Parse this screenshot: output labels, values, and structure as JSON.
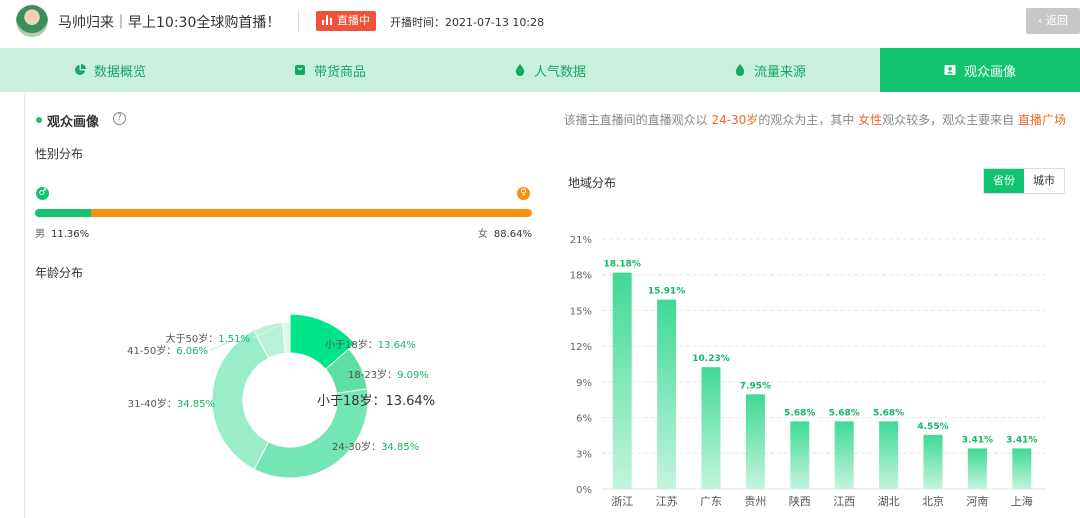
{
  "header": {
    "streamer_title": "马帅归来｜早上10:30全球购首播！",
    "live_badge": "直播中",
    "start_time_label": "开播时间：",
    "start_time": "2021-07-13 10:28",
    "back_label": "返回"
  },
  "tabs": [
    {
      "label": "数据概览",
      "icon": "pie-icon"
    },
    {
      "label": "带货商品",
      "icon": "bag-icon"
    },
    {
      "label": "人气数据",
      "icon": "drop-icon"
    },
    {
      "label": "流量来源",
      "icon": "drop-icon"
    },
    {
      "label": "观众画像",
      "icon": "portrait-icon",
      "active": true
    }
  ],
  "section": {
    "title": "观众画像",
    "summary": {
      "p1": "该播主直播间的直播观众以 ",
      "age": "24-30岁",
      "p2": "的观众为主，其中 ",
      "gender": "女性",
      "p3": "观众较多，观众主要来自 ",
      "source": "直播广场"
    }
  },
  "gender": {
    "title": "性别分布",
    "male_label": "男",
    "male_value": "11.36%",
    "male_fraction": 0.1136,
    "female_label": "女",
    "female_value": "88.64%",
    "colors": {
      "male": "#12c46e",
      "female": "#fa8e10"
    }
  },
  "age": {
    "title": "年龄分布",
    "center_label": "小于18岁：13.64%",
    "slices": [
      {
        "label": "小于18岁：",
        "value_text": "13.64%",
        "value": 13.64,
        "color": "#00e58a"
      },
      {
        "label": "18-23岁：",
        "value_text": "9.09%",
        "value": 9.09,
        "color": "#5ddfa3"
      },
      {
        "label": "24-30岁：",
        "value_text": "34.85%",
        "value": 34.85,
        "color": "#74e6b6"
      },
      {
        "label": "31-40岁：",
        "value_text": "34.85%",
        "value": 34.85,
        "color": "#9aedc9"
      },
      {
        "label": "41-50岁：",
        "value_text": "6.06%",
        "value": 6.06,
        "color": "#baf2d9"
      },
      {
        "label": "大于50岁：",
        "value_text": "1.51%",
        "value": 1.51,
        "color": "#d8f8ea"
      }
    ]
  },
  "region": {
    "title": "地域分布",
    "toggle": [
      "省份",
      "城市"
    ],
    "toggle_selected": "省份"
  },
  "chart_data": {
    "type": "bar",
    "categories": [
      "浙江",
      "江苏",
      "广东",
      "贵州",
      "陕西",
      "江西",
      "湖北",
      "北京",
      "河南",
      "上海"
    ],
    "values": [
      18.18,
      15.91,
      10.23,
      7.95,
      5.68,
      5.68,
      5.68,
      4.55,
      3.41,
      3.41
    ],
    "value_labels": [
      "18.18%",
      "15.91%",
      "10.23%",
      "7.95%",
      "5.68%",
      "5.68%",
      "5.68%",
      "4.55%",
      "3.41%",
      "3.41%"
    ],
    "yticks": [
      "0%",
      "3%",
      "6%",
      "9%",
      "12%",
      "15%",
      "18%",
      "21%"
    ],
    "ylim": [
      0,
      21
    ],
    "grid": true,
    "colors": {
      "bar_top": "#3fd995",
      "bar_bottom": "#c4f4de",
      "label": "#12b76a"
    }
  }
}
